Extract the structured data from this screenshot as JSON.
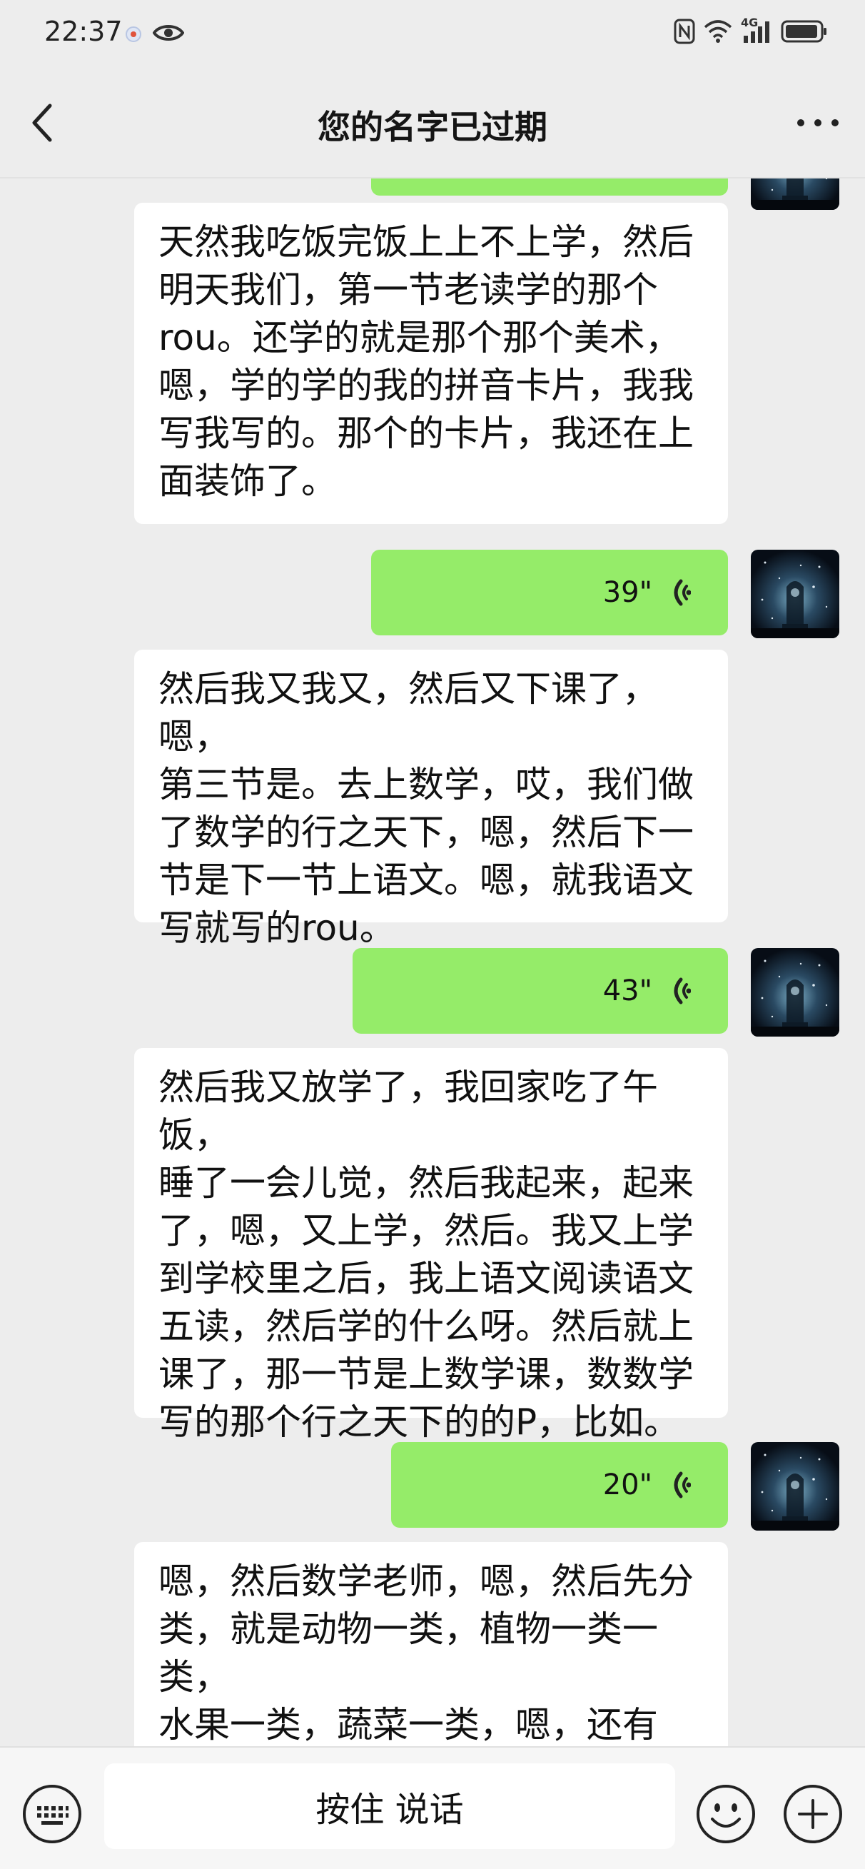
{
  "status_bar": {
    "time": "22:37",
    "network": "4G"
  },
  "header": {
    "title": "您的名字已过期"
  },
  "messages": [
    {
      "type": "voice",
      "side": "right",
      "duration": "39\""
    },
    {
      "type": "voice",
      "side": "right",
      "duration": "43\""
    },
    {
      "type": "voice",
      "side": "right",
      "duration": "20\""
    }
  ],
  "transcripts": [
    "天然我吃饭完饭上上不上学，然后\n明天我们，第一节老读学的那个\nrou。还学的就是那个那个美术，\n嗯，学的学的我的拼音卡片，我我\n写我写的。那个的卡片，我还在上\n面装饰了。",
    "然后我又我又，然后又下课了，嗯，\n第三节是。去上数学，哎，我们做\n了数学的行之天下，嗯，然后下一\n节是下一节上语文。嗯，就我语文\n写就写的rou。",
    "然后我又放学了，我回家吃了午饭，\n睡了一会儿觉，然后我起来，起来\n了，嗯，又上学，然后。我又上学\n到学校里之后，我上语文阅读语文\n五读，然后学的什么呀。然后就上\n课了，那一节是上数学课，数数学\n写的那个行之天下的的P，比如。",
    "嗯，然后数学老师，嗯，然后先分\n类，就是动物一类，植物一类一类，\n水果一类，蔬菜一类，嗯，还有\n吗。还有交通工具一类，天上飞的"
  ],
  "input_bar": {
    "hold_to_talk": "按住 说话"
  },
  "colors": {
    "bubble_self": "#95ec69",
    "bubble_transcript": "#ffffff",
    "background": "#ededed"
  }
}
